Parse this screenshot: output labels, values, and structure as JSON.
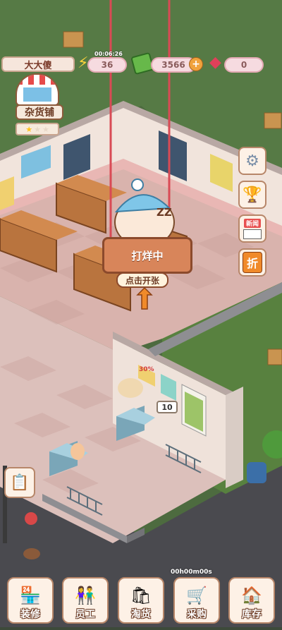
{
  "hud": {
    "player_name": "大大傻",
    "energy": {
      "icon": "lightning-icon",
      "value": "36",
      "timer": "00:06:26"
    },
    "cash": {
      "icon": "cash-icon",
      "value": "3566",
      "add": "+"
    },
    "gems": {
      "icon": "gem-icon",
      "value": "0"
    }
  },
  "shop": {
    "name": "杂货铺",
    "rating": 1,
    "rating_max": 3
  },
  "side_menu": [
    {
      "id": "settings",
      "icon": "gear-icon"
    },
    {
      "id": "trophy",
      "icon": "trophy-icon"
    },
    {
      "id": "news",
      "icon": "newspaper-icon",
      "label": "新闻"
    },
    {
      "id": "discount",
      "icon": "discount-icon",
      "label": "折"
    }
  ],
  "status_banner": {
    "text": "打烊中",
    "sleep": "ZZ",
    "open_hint": "点击开张"
  },
  "store_poster": {
    "sale": "30%"
  },
  "stock_count": "10",
  "task_icon": "clipboard-icon",
  "bottom_timer": "00h00m00s",
  "bottom_nav": [
    {
      "id": "decorate",
      "label": "装修",
      "icon": "shop-icon"
    },
    {
      "id": "staff",
      "label": "员工",
      "icon": "staff-icon"
    },
    {
      "id": "goods",
      "label": "淘货",
      "icon": "bag-icon"
    },
    {
      "id": "purchase",
      "label": "采购",
      "icon": "cart-icon"
    },
    {
      "id": "inventory",
      "label": "库存",
      "icon": "warehouse-icon"
    }
  ]
}
